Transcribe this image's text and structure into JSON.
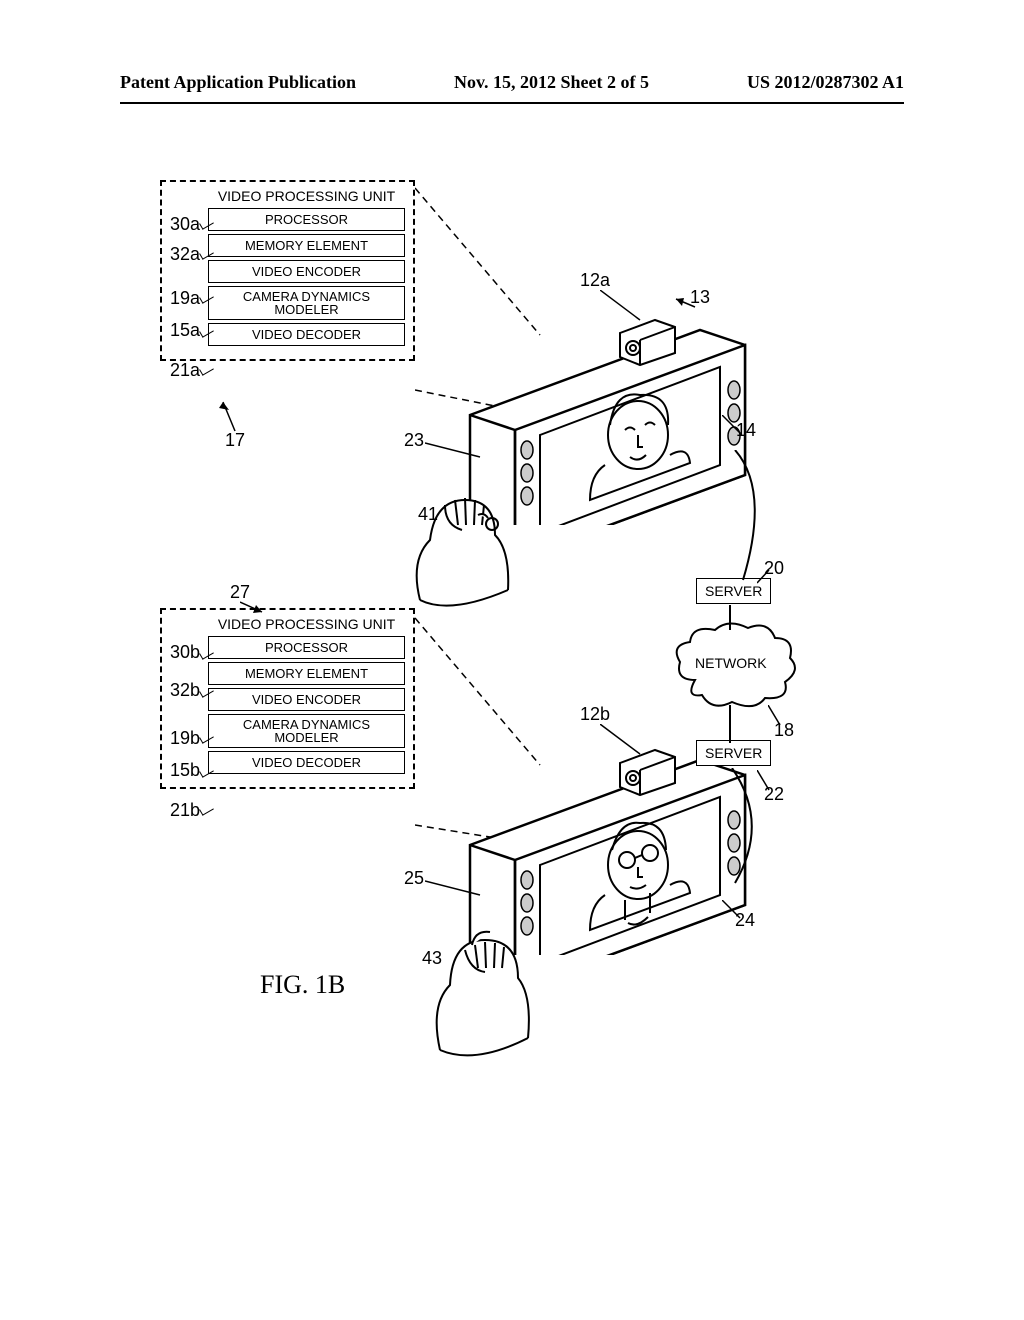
{
  "header": {
    "left": "Patent Application Publication",
    "center": "Nov. 15, 2012  Sheet 2 of 5",
    "right": "US 2012/0287302 A1"
  },
  "vpu_a": {
    "title": "VIDEO PROCESSING UNIT",
    "processor": "PROCESSOR",
    "memory": "MEMORY ELEMENT",
    "encoder": "VIDEO ENCODER",
    "modeler": "CAMERA DYNAMICS MODELER",
    "decoder": "VIDEO DECODER"
  },
  "vpu_b": {
    "title": "VIDEO PROCESSING UNIT",
    "processor": "PROCESSOR",
    "memory": "MEMORY ELEMENT",
    "encoder": "VIDEO ENCODER",
    "modeler": "CAMERA DYNAMICS MODELER",
    "decoder": "VIDEO DECODER"
  },
  "network": {
    "server_top": "SERVER",
    "cloud": "NETWORK",
    "server_bottom": "SERVER"
  },
  "ref": {
    "r30a": "30a",
    "r32a": "32a",
    "r19a": "19a",
    "r15a": "15a",
    "r21a": "21a",
    "r17": "17",
    "r12a": "12a",
    "r13": "13",
    "r23": "23",
    "r14": "14",
    "r41": "41",
    "r20": "20",
    "r27": "27",
    "r30b": "30b",
    "r32b": "32b",
    "r19b": "19b",
    "r15b": "15b",
    "r21b": "21b",
    "r12b": "12b",
    "r18": "18",
    "r22": "22",
    "r25": "25",
    "r24": "24",
    "r43": "43"
  },
  "figure_caption": "FIG. 1B"
}
